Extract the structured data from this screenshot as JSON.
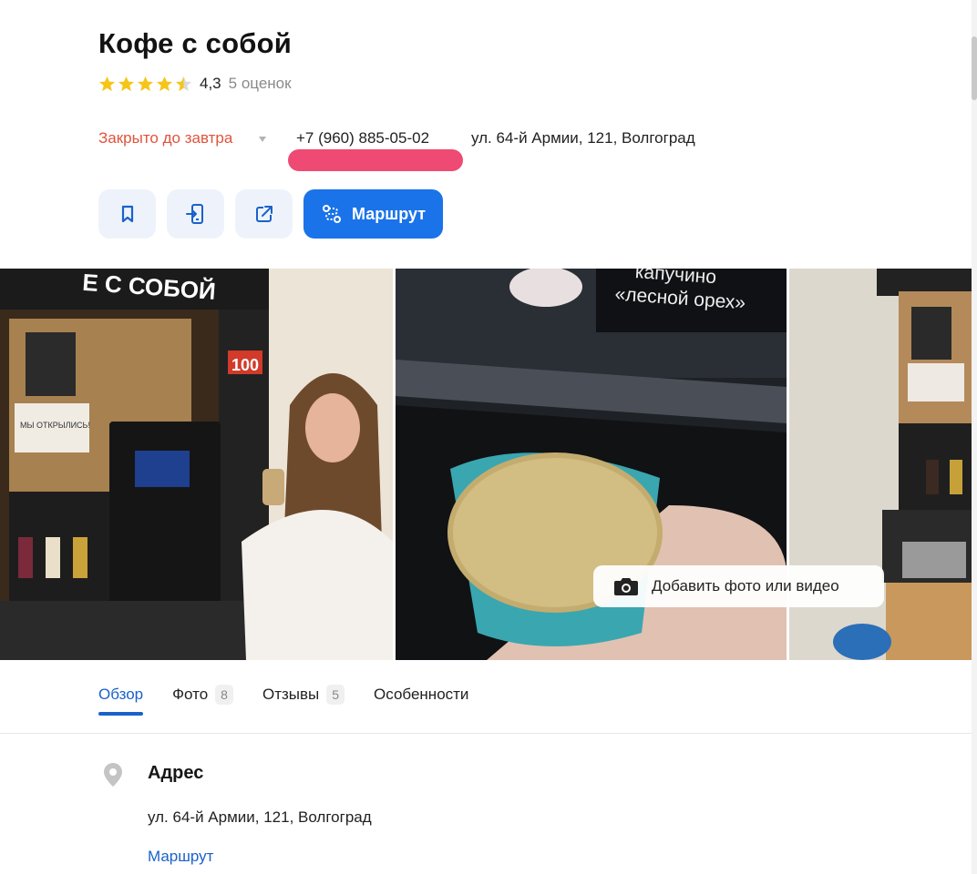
{
  "place": {
    "title": "Кофе с собой",
    "rating_value": "4,3",
    "rating_stars": 4.5,
    "rating_count": "5 оценок"
  },
  "info": {
    "status": "Закрыто до завтра",
    "phone": "+7 (960) 885-05-02",
    "address": "ул. 64-й Армии, 121, Волгоград"
  },
  "actions": {
    "bookmark_icon": "bookmark-icon",
    "send_to_phone_icon": "phone-send-icon",
    "share_icon": "share-icon",
    "route_label": "Маршрут"
  },
  "gallery": {
    "photo1_sign": "Е С СОБОЙ",
    "photo1_price": "100",
    "photo1_notice": "МЫ ОТКРЫЛИСЬ!",
    "photo2_caption_line1": "капучино",
    "photo2_caption_line2": "«лесной орех»",
    "add_media_label": "Добавить фото или видео"
  },
  "tabs": [
    {
      "label": "Обзор",
      "count": ""
    },
    {
      "label": "Фото",
      "count": "8"
    },
    {
      "label": "Отзывы",
      "count": "5"
    },
    {
      "label": "Особенности",
      "count": ""
    }
  ],
  "address_section": {
    "heading": "Адрес",
    "text": "ул. 64-й Армии, 121, Волгоград",
    "route_link": "Маршрут"
  },
  "colors": {
    "accent": "#1a73e8",
    "status_closed": "#e0533c",
    "highlight": "#ee4a73",
    "star": "#f5c518"
  }
}
